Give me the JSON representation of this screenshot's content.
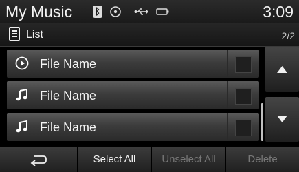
{
  "status_bar": {
    "title": "My Music",
    "time": "3:09"
  },
  "header": {
    "label": "List",
    "page": "2/2"
  },
  "list": {
    "items": [
      {
        "name": "File Name",
        "icon": "play-circle-icon",
        "checked": false
      },
      {
        "name": "File Name",
        "icon": "music-note-icon",
        "checked": false
      },
      {
        "name": "File Name",
        "icon": "music-note-icon",
        "checked": false
      }
    ]
  },
  "bottom_bar": {
    "back_icon": "back-arrow-icon",
    "select_all": "Select All",
    "unselect_all": "Unselect All",
    "delete": "Delete"
  },
  "colors": {
    "background": "#000000",
    "text": "#ffffff",
    "disabled_text": "#777777"
  }
}
